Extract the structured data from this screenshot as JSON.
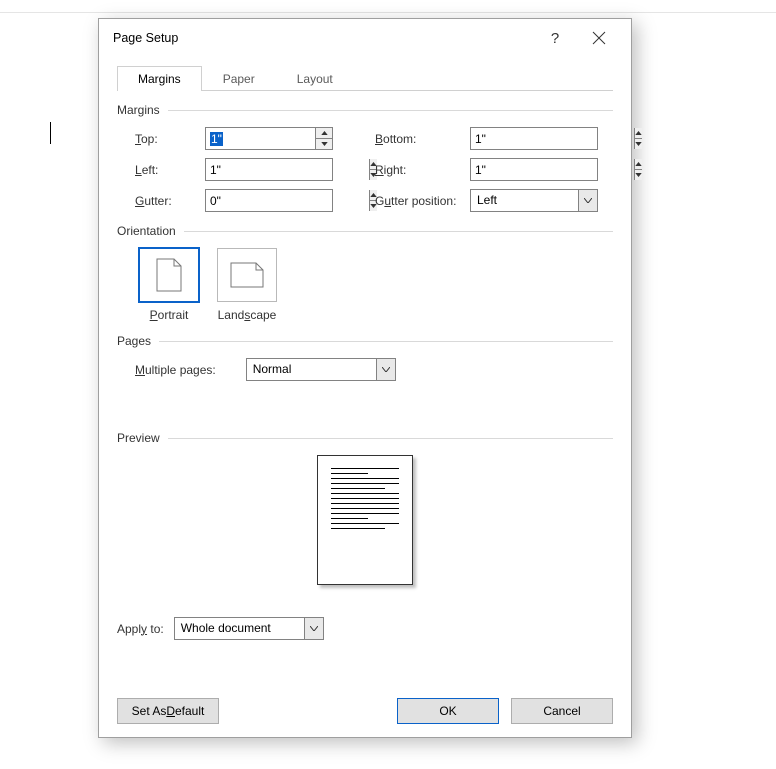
{
  "window": {
    "title": "Page Setup"
  },
  "tabs": {
    "t0": "Margins",
    "t1": "Paper",
    "t2": "Layout"
  },
  "sections": {
    "margins": "Margins",
    "orientation": "Orientation",
    "pages": "Pages",
    "preview": "Preview"
  },
  "margins": {
    "top_label": "Top:",
    "top_value": "1\"",
    "bottom_label": "Bottom:",
    "bottom_value": "1\"",
    "left_label": "Left:",
    "left_value": "1\"",
    "right_label": "Right:",
    "right_value": "1\"",
    "gutter_label": "Gutter:",
    "gutter_value": "0\"",
    "gutter_pos_label": "Gutter position:",
    "gutter_pos_value": "Left"
  },
  "orientation": {
    "portrait": "Portrait",
    "landscape": "Landscape"
  },
  "pages": {
    "multiple_label": "Multiple pages:",
    "multiple_value": "Normal"
  },
  "apply": {
    "label": "Apply to:",
    "value": "Whole document"
  },
  "buttons": {
    "default": "Set As Default",
    "ok": "OK",
    "cancel": "Cancel"
  }
}
